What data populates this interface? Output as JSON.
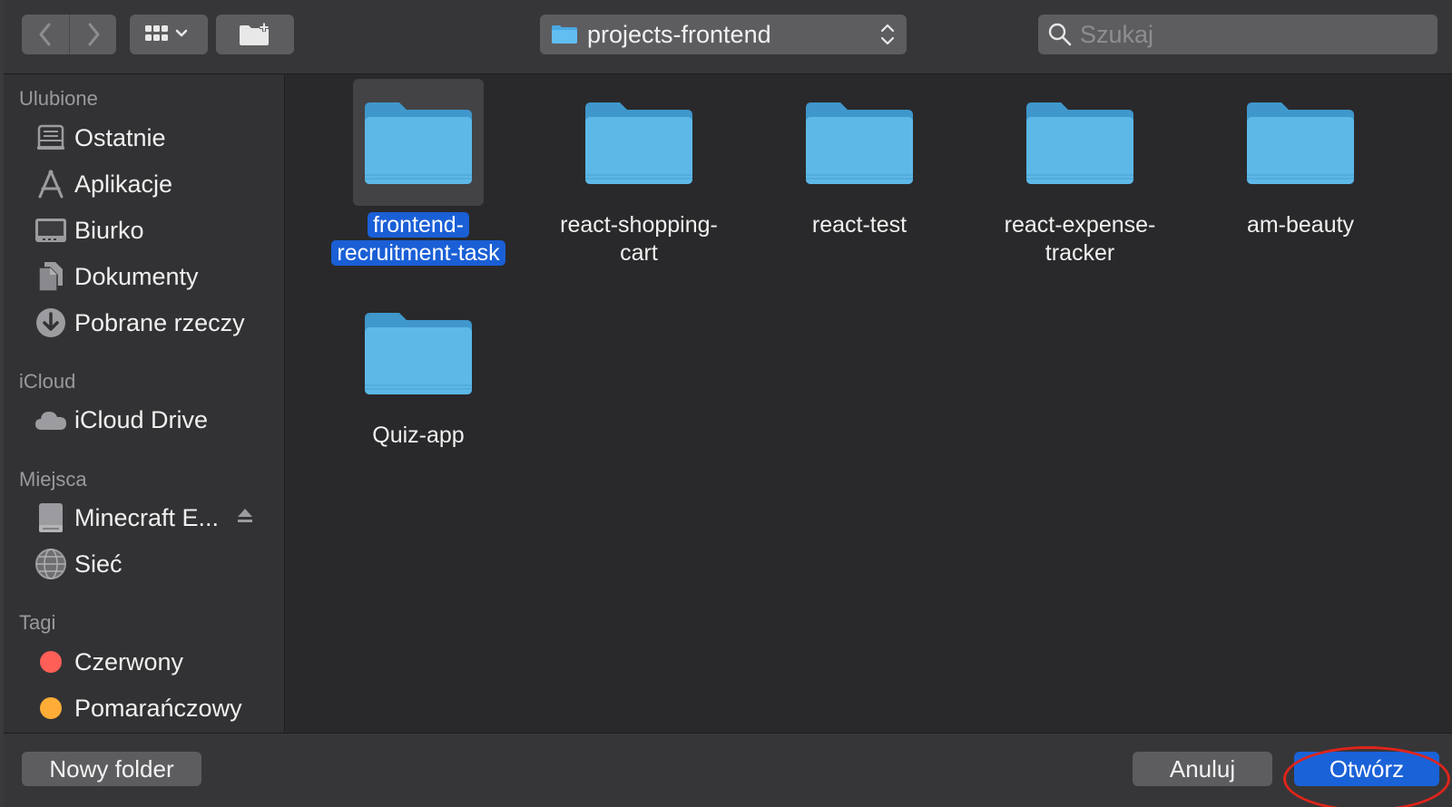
{
  "toolbar": {
    "path_label": "projects-frontend",
    "search_placeholder": "Szukaj",
    "icons": {
      "back": "chevron-left-icon",
      "forward": "chevron-right-icon",
      "view": "icon-grid-view-icon",
      "new_folder": "new-folder-icon",
      "path_arrows": "up-down-arrows-icon",
      "search": "search-icon"
    }
  },
  "sidebar": {
    "favorites_title": "Ulubione",
    "favorites": [
      {
        "label": "Ostatnie",
        "icon": "recents-icon"
      },
      {
        "label": "Aplikacje",
        "icon": "applications-icon"
      },
      {
        "label": "Biurko",
        "icon": "desktop-icon"
      },
      {
        "label": "Dokumenty",
        "icon": "documents-icon"
      },
      {
        "label": "Pobrane rzeczy",
        "icon": "downloads-icon"
      }
    ],
    "icloud_title": "iCloud",
    "icloud": [
      {
        "label": "iCloud Drive",
        "icon": "cloud-icon"
      }
    ],
    "places_title": "Miejsca",
    "places": [
      {
        "label": "Minecraft E...",
        "icon": "disk-icon"
      },
      {
        "label": "Sieć",
        "icon": "network-icon"
      }
    ],
    "tags_title": "Tagi",
    "tags": [
      {
        "label": "Czerwony",
        "color": "#ff5f57"
      },
      {
        "label": "Pomarańczowy",
        "color": "#ffad36"
      }
    ]
  },
  "files": [
    {
      "name": "frontend-recruitment-task",
      "line1": "frontend-",
      "line2": "recruitment-task",
      "selected": true
    },
    {
      "name": "react-shopping-cart",
      "line1": "react-shopping-",
      "line2": "cart",
      "selected": false
    },
    {
      "name": "react-test",
      "line1": "react-test",
      "line2": "",
      "selected": false
    },
    {
      "name": "react-expense-tracker",
      "line1": "react-expense-",
      "line2": "tracker",
      "selected": false
    },
    {
      "name": "am-beauty",
      "line1": "am-beauty",
      "line2": "",
      "selected": false
    },
    {
      "name": "Quiz-app",
      "line1": "Quiz-app",
      "line2": "",
      "selected": false
    }
  ],
  "bottom": {
    "new_folder_label": "Nowy folder",
    "cancel_label": "Anuluj",
    "open_label": "Otwórz"
  },
  "colors": {
    "folder": "#5db8e8",
    "selection": "#1a5fd6",
    "open_button": "#1a62d8",
    "annotation_ring": "#e0241b"
  }
}
